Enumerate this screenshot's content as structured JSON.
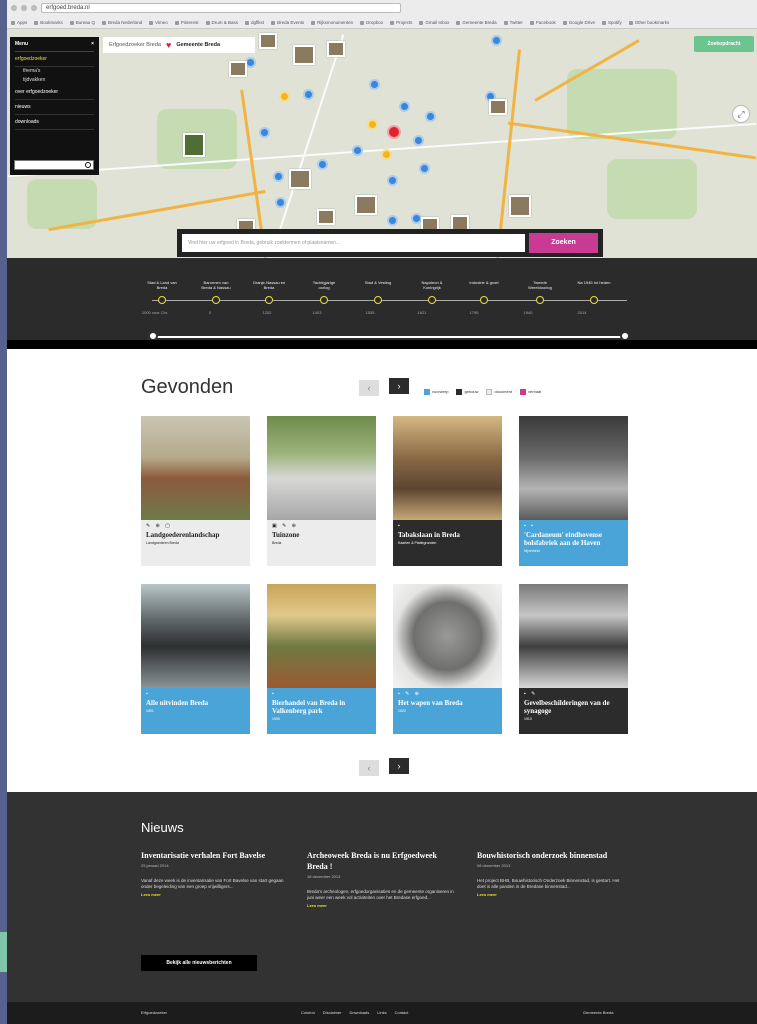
{
  "browser": {
    "url": "erfgoed.breda.nl",
    "bookmarks": [
      "Apps",
      "Bookmarks",
      "Bureau Q",
      "Breda Nederland",
      "Vimeo",
      "Pinterest",
      "Drum & Bass",
      "dgflkst",
      "Breda Events",
      "Rijksmonumenten",
      "Dropbox",
      "Projects",
      "Gmail Inbox",
      "Gemeente Breda",
      "Twitter",
      "Facebook",
      "Google Drive",
      "Spotify",
      "Other bookmarks"
    ]
  },
  "map": {
    "menu": {
      "title": "Menu",
      "close": "×",
      "items": [
        {
          "label": "erfgoedzoeker",
          "active": true
        },
        {
          "label": "thema's",
          "sub": true
        },
        {
          "label": "tijdvakken",
          "sub": true
        },
        {
          "label": "over erfgoedzoeker"
        },
        {
          "label": "nieuws"
        },
        {
          "label": "downloads"
        }
      ]
    },
    "brand": {
      "left": "Erfgoedzoeker Breda",
      "right": "Gemeente Breda"
    },
    "zoek_tab": "Zoekopdracht",
    "search_placeholder": "Vind hier uw erfgoed in Breda, gebruik zoektermen of plaatsnamen...",
    "search_button": "Zoeken"
  },
  "timeline": {
    "labels": [
      "Stad & Land van Breda",
      "Baronnen van Breda & Nassau",
      "Oranje-Nassau en Breda",
      "Tachtigjarige oorlog",
      "Stad & Vesting",
      "Napoleon & Koningrijk",
      "Industrie & groei",
      "Tweede Wereldoorlog",
      "Na 1945 tot heden"
    ],
    "years": [
      "1000 voor Chr.",
      "0",
      "1252",
      "1403",
      "1535",
      "1621",
      "1795",
      "1940",
      "2014"
    ]
  },
  "results": {
    "title": "Gevonden",
    "prev": "‹",
    "next": "›",
    "legend": [
      {
        "label": "voorwerp",
        "color": "#4ba4d7"
      },
      {
        "label": "gebouw",
        "color": "#2c2c2c"
      },
      {
        "label": "document",
        "color": "#ececec"
      },
      {
        "label": "verhaal",
        "color": "#c93b93"
      }
    ],
    "cards": [
      {
        "icons": "✎ ⊕ ▢",
        "title": "Landgoederenlandschap",
        "sub": "Landgoederen Breda",
        "style": "grey"
      },
      {
        "icons": "▣ ✎ ⊕",
        "title": "Tuinzone",
        "sub": "Breda",
        "style": "grey"
      },
      {
        "icons": "▪",
        "title": "Tabakslaan in Breda",
        "sub": "Kaarten & Plattegronden",
        "style": "dark"
      },
      {
        "icons": "▪ ▪",
        "title": "'Cardaneum' eindhovense bolsfabriek aan de Haven",
        "sub": "Nijverheid",
        "style": "blue"
      },
      {
        "icons": "▪",
        "title": "Alle uitvinden Breda",
        "sub": "1891",
        "style": "blue"
      },
      {
        "icons": "▪",
        "title": "Bierhandel van Breda in Valkenberg park",
        "sub": "1905",
        "style": "blue"
      },
      {
        "icons": "▪ ✎ ⊕",
        "title": "Het wapen van Breda",
        "sub": "1520",
        "style": "blue"
      },
      {
        "icons": "▪ ✎",
        "title": "Gevelbeschilderingen van de synagoge",
        "sub": "1910",
        "style": "dark"
      }
    ]
  },
  "news": {
    "title": "Nieuws",
    "items": [
      {
        "title": "Inventarisatie verhalen Fort Bavelse",
        "date": "25 januari 2014",
        "text": "Vanaf deze week is de inventarisatie van Fort Bavelse van start gegaan onder begeleiding van een groep vrijwilligers...",
        "more": "Lees meer"
      },
      {
        "title": "Archeoweek Breda is nu Erfgoedweek Breda !",
        "date": "16 december 2013",
        "text": "Breda's archeologen, erfgoedorganisaties en de gemeente organiseren in juni weer een week vol activiteiten over het Bredase erfgoed...",
        "more": "Lees meer"
      },
      {
        "title": "Bouwhistorisch onderzoek binnenstad",
        "date": "08 december 2013",
        "text": "Het project BHB, Bouwhistorisch Onderzoek Binnenstad, is gestart. Het doel is alle panden in de Bredase binnenstad...",
        "more": "Lees meer"
      }
    ],
    "all_button": "Bekijk alle nieuwsberichten"
  },
  "footer": {
    "left": "Erfgoedzoeker",
    "links": [
      "Colofon",
      "Disclaimer",
      "Downloads",
      "Links",
      "Contact"
    ],
    "right": "Gemeente Breda"
  }
}
